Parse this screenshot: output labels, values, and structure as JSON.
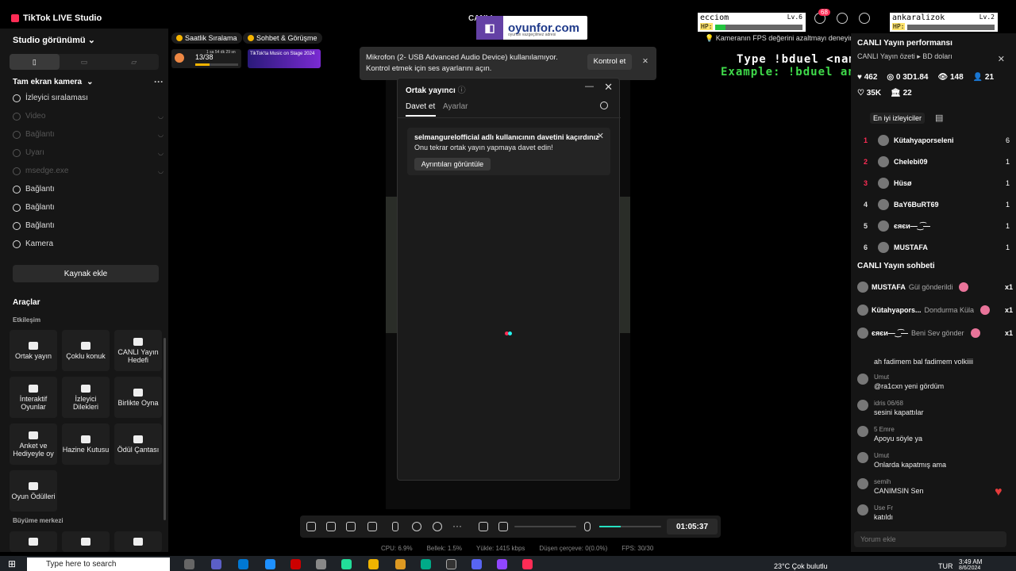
{
  "window": {
    "app_title": "TikTok LIVE Studio",
    "center_title": "CANLI",
    "notif_count": "68"
  },
  "sidebar": {
    "header": "Studio görünümü",
    "scene_label": "Tam ekran kamera",
    "sources": [
      {
        "label": "İzleyici sıralaması",
        "enabled": true
      },
      {
        "label": "Video",
        "enabled": false
      },
      {
        "label": "Bağlantı",
        "enabled": false
      },
      {
        "label": "Uyarı",
        "enabled": false
      },
      {
        "label": "msedge.exe",
        "enabled": false
      },
      {
        "label": "Bağlantı",
        "enabled": true
      },
      {
        "label": "Bağlantı",
        "enabled": true
      },
      {
        "label": "Bağlantı",
        "enabled": true
      },
      {
        "label": "Kamera",
        "enabled": true
      }
    ],
    "add_source": "Kaynak ekle",
    "tools_heading": "Araçlar",
    "interaction_heading": "Etkileşim",
    "growth_heading": "Büyüme merkezi",
    "tools": [
      {
        "label": "Ortak yayın",
        "icon": "link-icon"
      },
      {
        "label": "Çoklu konuk",
        "icon": "users-icon"
      },
      {
        "label": "CANLI Yayın Hedefi",
        "icon": "target-icon"
      },
      {
        "label": "İnteraktif Oyunlar",
        "icon": "gamepad-icon"
      },
      {
        "label": "İzleyici Dilekleri",
        "icon": "gift-icon"
      },
      {
        "label": "Birlikte Oyna",
        "icon": "play-together-icon"
      },
      {
        "label": "Anket ve Hediyeyle oy",
        "icon": "poll-icon"
      },
      {
        "label": "Hazine Kutusu",
        "icon": "treasure-icon"
      },
      {
        "label": "Ödül Çantası",
        "icon": "bag-icon"
      },
      {
        "label": "Oyun Ödülleri",
        "icon": "trophy-icon"
      }
    ]
  },
  "canvas": {
    "pill1": "Saatlik Sıralama",
    "pill2": "Sohbet & Görüşme",
    "ranking_progress": "13/38",
    "ranking_timer": "1 sa 54 dk 29 sn",
    "ranking_fill": 0.34,
    "banner_text": "TikTok'ta Music on Stage 2024",
    "twitch_brand": "oyunfor.com",
    "twitch_sub": "oyunun vazgeçilmez adresi",
    "player1": {
      "name": "ecciom",
      "level": "Lv.6",
      "hp_label": "HP:",
      "hp": 0.12
    },
    "player2": {
      "name": "ankaralizok",
      "level": "Lv.2",
      "hp_label": "HP:",
      "hp": 0.0
    },
    "fps_warning": "Kameranın FPS değerini azaltmayı deneyin",
    "cmd_line1": "Type !bduel <name> to play",
    "cmd_line2": "Example: !bduel ankaralizoktay"
  },
  "toast": {
    "message": "Mikrofon (2- USB Advanced Audio Device) kullanılamıyor. Kontrol etmek için ses ayarlarını açın.",
    "button": "Kontrol et"
  },
  "dialog": {
    "title": "Ortak yayıncı",
    "tabs": [
      "Davet et",
      "Ayarlar"
    ],
    "invite_bold": "selmangureIofficial adlı kullanıcının davetini kaçırdınız",
    "invite_sub": "Onu tekrar ortak yayın yapmaya davet edin!",
    "view_button": "Ayrıntıları görüntüle"
  },
  "controls": {
    "timer": "01:05:37",
    "mic_level": 0.34
  },
  "stats": {
    "cpu": "CPU: 6.9%",
    "memory": "Bellek: 1.5%",
    "upload": "Yükle: 1415 kbps",
    "dropped": "Düşen çerçeve: 0(0.0%)",
    "fps": "FPS: 30/30"
  },
  "right_panel": {
    "perf_title": "CANLI Yayın performansı",
    "perf_summary": "CANLI Yayın özeti ▸ BD doları",
    "stats1": [
      "♥ 462",
      "◎ 0 3D1.84",
      "👁 148",
      "👤 21"
    ],
    "stats2": [
      "♡ 35K",
      "🏛 22"
    ],
    "top_viewers_title": "En iyi izleyiciler",
    "viewers": [
      {
        "rank": "1",
        "name": "Kütahyaporseleni",
        "count": "6",
        "color": "#fe2c55"
      },
      {
        "rank": "2",
        "name": "Chelebi09",
        "count": "1",
        "color": "#fe2c55"
      },
      {
        "rank": "3",
        "name": "Hüsø",
        "count": "1",
        "color": "#fe2c55"
      },
      {
        "rank": "4",
        "name": "BaY6BuRT69",
        "count": "1",
        "color": "#ddd"
      },
      {
        "rank": "5",
        "name": "єяєи—‿͡—",
        "count": "1",
        "color": "#ddd"
      },
      {
        "rank": "6",
        "name": "MUSTAFA",
        "count": "1",
        "color": "#ddd"
      }
    ],
    "chat_title": "CANLI Yayın sohbeti",
    "gifts": [
      {
        "user": "MUSTAFA",
        "text": "Gül gönderildi",
        "count": "x1"
      },
      {
        "user": "Kütahyapors...",
        "text": "Dondurma Küla",
        "count": "x1"
      },
      {
        "user": "єяєи—‿͡—",
        "text": "Beni Sev gönder",
        "count": "x1"
      }
    ],
    "chat_first": "ah fadimem bal fadimem volkiiii",
    "chats": [
      {
        "user": "Umut",
        "text": "@ra1cxn yeni gördüm"
      },
      {
        "user": "idris 06/68",
        "text": "sesini kapattılar"
      },
      {
        "user": "5 Emre",
        "text": "Apoyu söyle ya"
      },
      {
        "user": "Umut",
        "text": "Onlarda kapatmış ama"
      },
      {
        "user": "semih",
        "text": "CANIMSIN Sen"
      },
      {
        "user": "Use Fr",
        "text": "katıldı"
      }
    ],
    "comment_placeholder": "Yorum ekle"
  },
  "taskbar": {
    "search": "Type here to search",
    "weather": "23°C  Çok bulutlu",
    "lang": "TUR",
    "time": "3:49 AM",
    "date": "8/6/2024"
  }
}
